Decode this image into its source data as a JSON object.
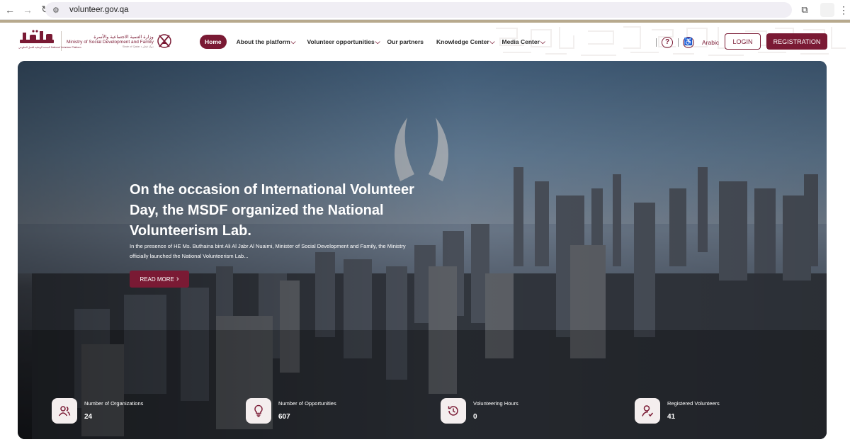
{
  "browser": {
    "url": "volunteer.gov.qa"
  },
  "header": {
    "logo_arabic": "تطوع",
    "logo_subtitle": "المنصة الوطنية للعمل التطوعي National Volunteer Platform",
    "ministry_ar": "وزارة التنمية الاجتماعية والأسرة",
    "ministry_en": "Ministry of Social Development and Family",
    "state": "State of Qatar • دولة قطر",
    "nav": [
      {
        "label": "Home",
        "dropdown": false,
        "active": true
      },
      {
        "label": "About the platform",
        "dropdown": true
      },
      {
        "label": "Volunteer opportunities",
        "dropdown": true
      },
      {
        "label": "Our partners",
        "dropdown": false
      },
      {
        "label": "Knowledge Center",
        "dropdown": true
      },
      {
        "label": "Media Center",
        "dropdown": true
      }
    ],
    "language": "Arabic",
    "login": "LOGIN",
    "register": "REGISTRATION"
  },
  "hero": {
    "title": "On the occasion of International Volunteer Day, the MSDF organized the National Volunteerism Lab.",
    "description": "In the presence of HE Ms. Buthaina bint Ali Al Jabr Al Nuaimi, Minister of Social Development and Family, the Ministry officially launched the National Volunteerism Lab...",
    "read_more": "READ MORE",
    "read_more_arrow": "›"
  },
  "stats": [
    {
      "label": "Number of Organizations",
      "value": "24",
      "icon": "users-icon"
    },
    {
      "label": "Number of Opportunities",
      "value": "607",
      "icon": "lightbulb-icon"
    },
    {
      "label": "Volunteering Hours",
      "value": "0",
      "icon": "history-icon"
    },
    {
      "label": "Registered Volunteers",
      "value": "41",
      "icon": "user-check-icon"
    }
  ],
  "colors": {
    "brand": "#7a1a34",
    "accent_gold": "#b7a98d"
  }
}
